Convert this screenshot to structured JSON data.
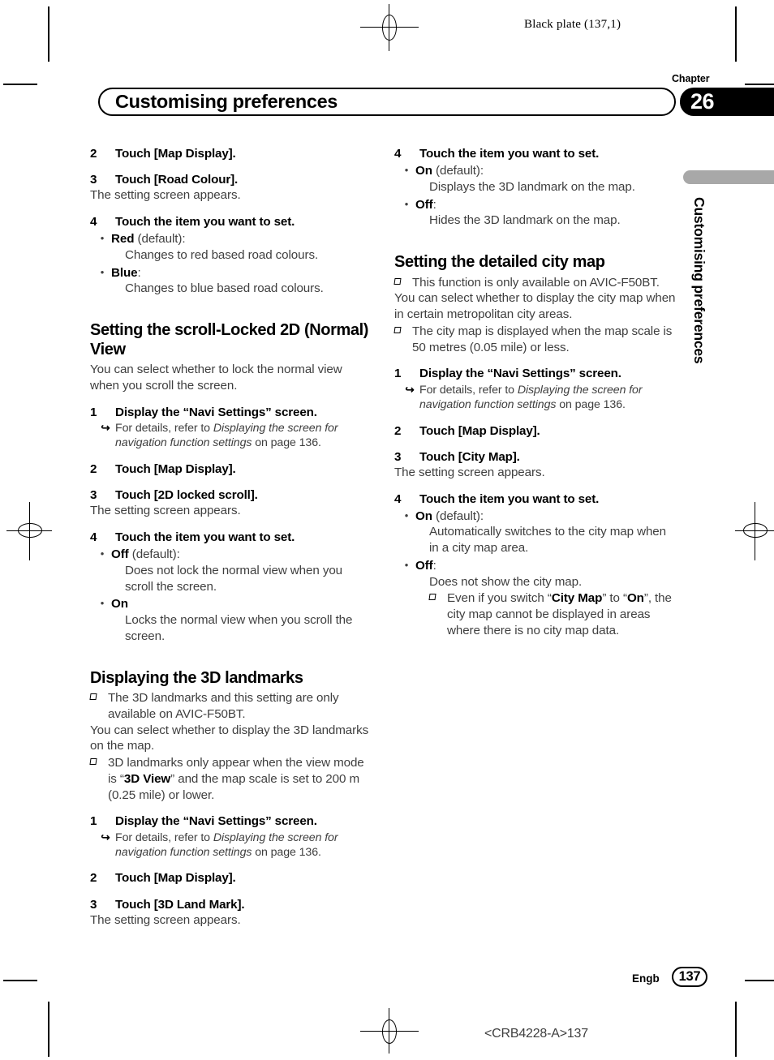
{
  "print_marks": {
    "plate_note": "Black plate (137,1)",
    "doc_code": "<CRB4228-A>137"
  },
  "header": {
    "chapter_label": "Chapter",
    "chapter_number": "26",
    "running_title": "Customising preferences",
    "side_tab_title": "Customising preferences"
  },
  "footer": {
    "language": "Engb",
    "page_number": "137"
  },
  "colors": {
    "text": "#3f3f3f",
    "heading": "#000000",
    "badge_bg": "#000000",
    "tab_gray": "#a8a8a8"
  },
  "left_column": {
    "step2_num": "2",
    "step2_text": "Touch [Map Display].",
    "step3_num": "3",
    "step3_text": "Touch [Road Colour].",
    "step3_after": "The setting screen appears.",
    "step4_num": "4",
    "step4_text": "Touch the item you want to set.",
    "bullet_dot": "•",
    "opt_red_bold": "Red",
    "opt_red_rest": " (default):",
    "opt_red_desc": "Changes to red based road colours.",
    "opt_blue_bold": "Blue",
    "opt_blue_rest": ":",
    "opt_blue_desc": "Changes to blue based road colours.",
    "heading_scroll": "Setting the scroll-Locked 2D (Normal) View",
    "scroll_intro": "You can select whether to lock the normal view when you scroll the screen.",
    "s1_num": "1",
    "s1_text": "Display the “Navi Settings” screen.",
    "xref_arrow": "↪",
    "xref_pre": "For details, refer to ",
    "xref_italic": "Displaying the screen for navigation function settings",
    "xref_post": " on page 136.",
    "s2_num": "2",
    "s2_text": "Touch [Map Display].",
    "s3_num": "3",
    "s3_text": "Touch [2D locked scroll].",
    "s3_after": "The setting screen appears.",
    "s4_num": "4",
    "s4_text": "Touch the item you want to set.",
    "opt_off_bold": "Off",
    "opt_off_rest": " (default):",
    "opt_off_desc": "Does not lock the normal view when you scroll the screen.",
    "opt_on_bold": "On",
    "opt_on_rest": "",
    "opt_on_desc": "Locks the normal view when you scroll the screen.",
    "heading_3d": "Displaying the 3D landmarks",
    "note_3d_1": "The 3D landmarks and this setting are only available on AVIC-F50BT.",
    "intro_3d": "You can select whether to display the 3D landmarks on the map.",
    "note_3d_2_pre": "3D landmarks only appear when the view mode is “",
    "note_3d_2_bold": "3D View",
    "note_3d_2_post": "” and the map scale is set to 200 m (0.25 mile) or lower.",
    "l1_num": "1",
    "l1_text": "Display the “Navi Settings” screen.",
    "l2_num": "2",
    "l2_text": "Touch [Map Display].",
    "l3_num": "3",
    "l3_text": "Touch [3D Land Mark].",
    "l3_after": "The setting screen appears."
  },
  "right_column": {
    "r4_num": "4",
    "r4_text": "Touch the item you want to set.",
    "bullet_dot": "•",
    "opt_on_bold": "On",
    "opt_on_rest": " (default):",
    "opt_on_desc": "Displays the 3D landmark on the map.",
    "opt_off_bold": "Off",
    "opt_off_rest": ":",
    "opt_off_desc": "Hides the 3D landmark on the map.",
    "heading_city": "Setting the detailed city map",
    "note_city_1": "This function is only available on AVIC-F50BT.",
    "intro_city": "You can select whether to display the city map when in certain metropolitan city areas.",
    "note_city_2": "The city map is displayed when the map scale is 50 metres (0.05 mile) or less.",
    "c1_num": "1",
    "c1_text": "Display the “Navi Settings” screen.",
    "xref_arrow": "↪",
    "xref_pre": "For details, refer to ",
    "xref_italic": "Displaying the screen for navigation function settings",
    "xref_post": " on page 136.",
    "c2_num": "2",
    "c2_text": "Touch [Map Display].",
    "c3_num": "3",
    "c3_text": "Touch [City Map].",
    "c3_after": "The setting screen appears.",
    "c4_num": "4",
    "c4_text": "Touch the item you want to set.",
    "copt_on_bold": "On",
    "copt_on_rest": " (default):",
    "copt_on_desc": "Automatically switches to the city map when in a city map area.",
    "copt_off_bold": "Off",
    "copt_off_rest": ":",
    "copt_off_desc": "Does not show the city map.",
    "note_city_3_pre": "Even if you switch “",
    "note_city_3_b1": "City Map",
    "note_city_3_mid": "” to “",
    "note_city_3_b2": "On",
    "note_city_3_post": "”, the city map cannot be displayed in areas where there is no city map data."
  }
}
